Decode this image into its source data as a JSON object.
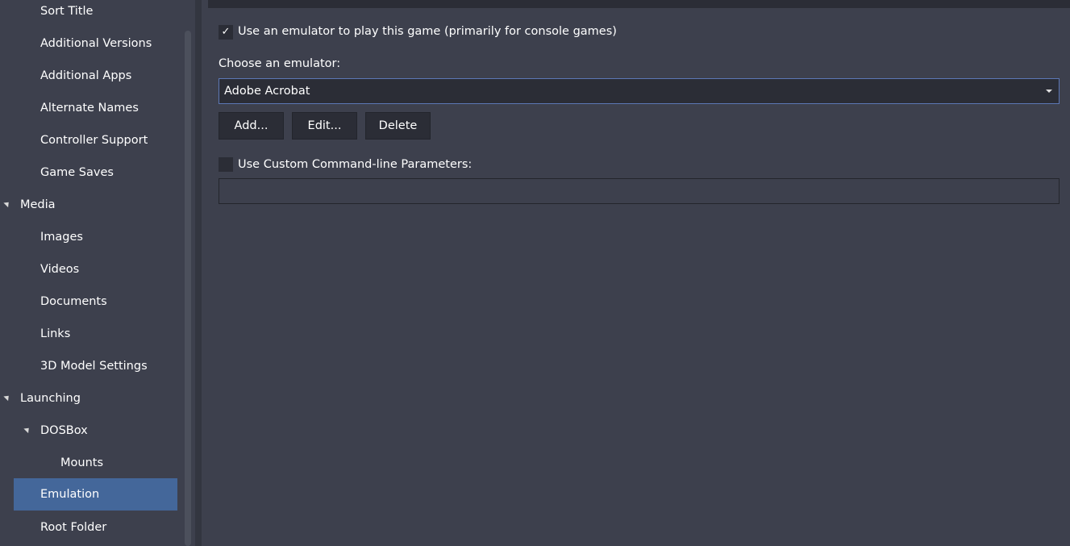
{
  "sidebar": {
    "items": [
      {
        "label": "Sort Title"
      },
      {
        "label": "Additional Versions"
      },
      {
        "label": "Additional Apps"
      },
      {
        "label": "Alternate Names"
      },
      {
        "label": "Controller Support"
      },
      {
        "label": "Game Saves"
      },
      {
        "label": "Media"
      },
      {
        "label": "Images"
      },
      {
        "label": "Videos"
      },
      {
        "label": "Documents"
      },
      {
        "label": "Links"
      },
      {
        "label": "3D Model Settings"
      },
      {
        "label": "Launching"
      },
      {
        "label": "DOSBox"
      },
      {
        "label": "Mounts"
      },
      {
        "label": "Emulation"
      },
      {
        "label": "Root Folder"
      }
    ],
    "selected": "Emulation"
  },
  "emulation": {
    "use_emulator_checked": true,
    "use_emulator_label": "Use an emulator to play this game (primarily for console games)",
    "choose_label": "Choose an emulator:",
    "selected_emulator": "Adobe Acrobat",
    "add_label": "Add...",
    "edit_label": "Edit...",
    "delete_label": "Delete",
    "custom_params_checked": false,
    "custom_params_label": "Use Custom Command-line Parameters:",
    "custom_params_value": ""
  },
  "colors": {
    "background": "#3d404d",
    "input_background": "#2b2d36",
    "selection": "#44679a",
    "focus_border": "#5c77b5"
  }
}
